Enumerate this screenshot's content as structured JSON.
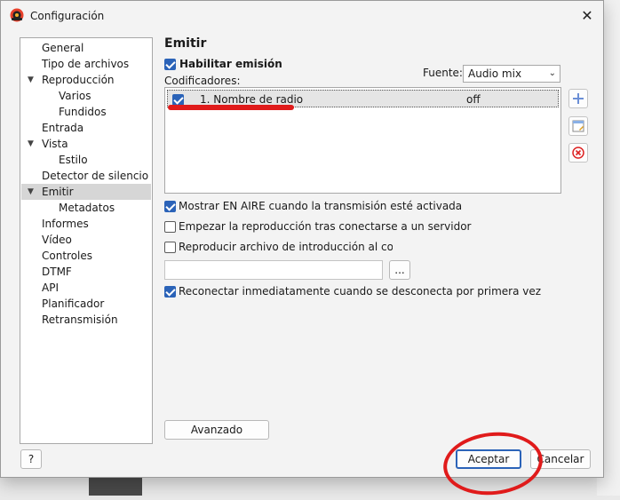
{
  "dialog": {
    "title": "Configuración",
    "close_glyph": "✕"
  },
  "nav": {
    "items": [
      {
        "label": "General"
      },
      {
        "label": "Tipo de archivos"
      },
      {
        "label": "Reproducción",
        "expanded": true
      },
      {
        "label": "Varios"
      },
      {
        "label": "Fundidos"
      },
      {
        "label": "Entrada"
      },
      {
        "label": "Vista",
        "expanded": true
      },
      {
        "label": "Estilo"
      },
      {
        "label": "Detector de silencio"
      },
      {
        "label": "Emitir",
        "expanded": true,
        "selected": true
      },
      {
        "label": "Metadatos"
      },
      {
        "label": "Informes"
      },
      {
        "label": "Vídeo"
      },
      {
        "label": "Controles"
      },
      {
        "label": "DTMF"
      },
      {
        "label": "API"
      },
      {
        "label": "Planificador"
      },
      {
        "label": "Retransmisión"
      }
    ]
  },
  "main": {
    "section_title": "Emitir",
    "enable_broadcast_label": "Habilitar emisión",
    "enable_broadcast_checked": true,
    "source_label": "Fuente:",
    "source_value": "Audio mix",
    "encoders_label": "Codificadores:",
    "encoders": [
      {
        "name": "1. Nombre de radio",
        "status": "off",
        "checked": true
      }
    ],
    "options": [
      {
        "label": "Mostrar EN AIRE cuando la transmisión esté activada",
        "checked": true
      },
      {
        "label": "Empezar la reproducción tras conectarse a un servidor",
        "checked": false
      },
      {
        "label": "Reproducir archivo de introducción al conecta",
        "checked": false
      }
    ],
    "intro_file_value": "",
    "browse_label": "...",
    "reconnect_label": "Reconectar inmediatamente cuando se desconecta por primera vez",
    "reconnect_checked": true,
    "advanced_label": "Avanzado"
  },
  "footer": {
    "help_label": "?",
    "ok_label": "Aceptar",
    "cancel_label": "Cancelar"
  },
  "icons": {
    "app": "app-logo-icon",
    "add": "plus-icon",
    "edit": "edit-icon",
    "remove": "remove-icon"
  },
  "colors": {
    "accent": "#2b63b8",
    "annotation": "#e01b1b",
    "selected_bg": "#d6d6d6"
  }
}
